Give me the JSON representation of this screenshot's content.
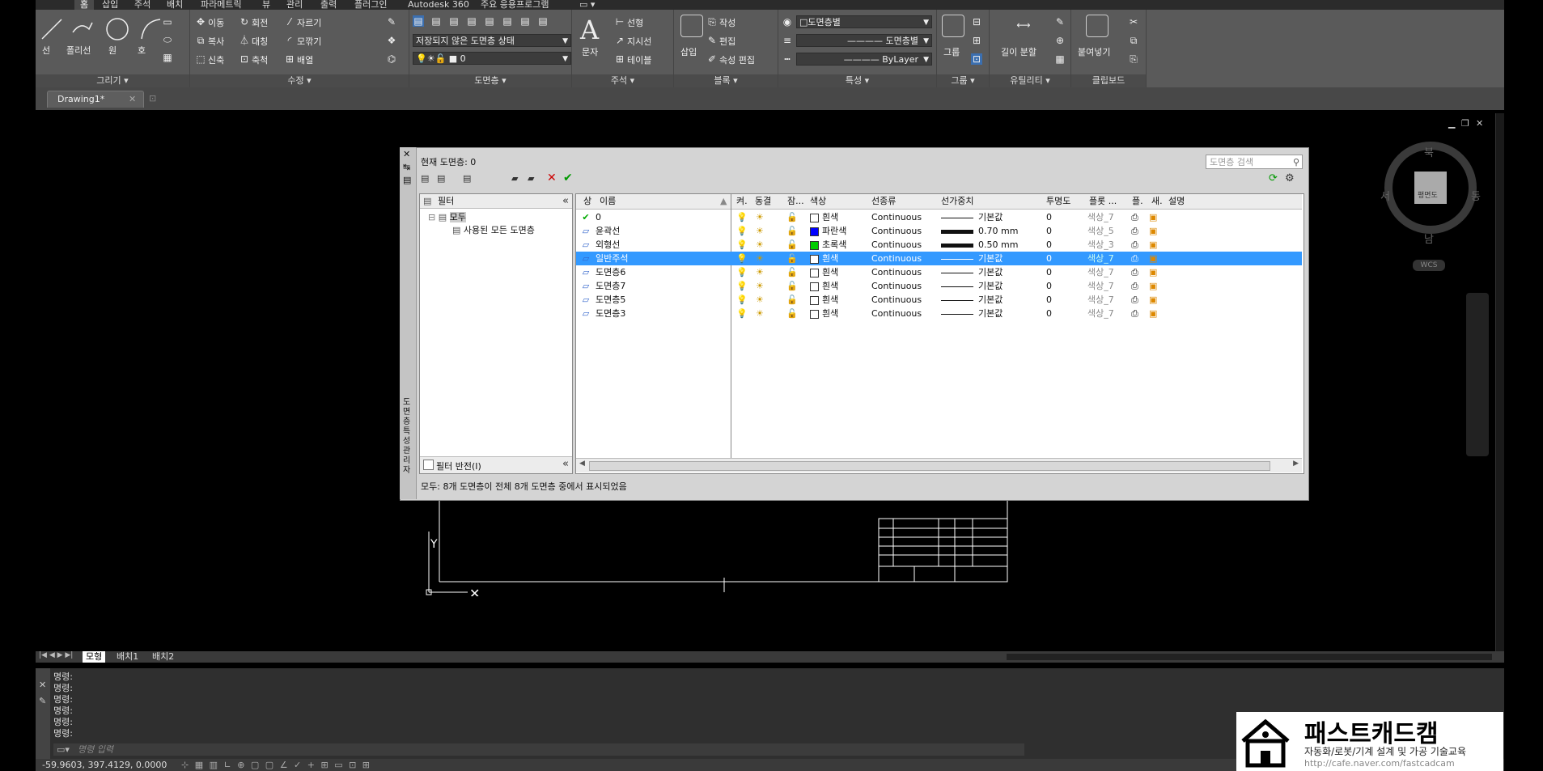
{
  "menu": {
    "tabs": [
      "홈",
      "삽입",
      "주석",
      "배치",
      "파라메트릭",
      "뷰",
      "관리",
      "출력",
      "플러그인",
      "Autodesk 360",
      "주요 응용프로그램"
    ]
  },
  "ribbon": {
    "draw": {
      "title": "그리기 ▾",
      "line": "선",
      "polyline": "폴리선",
      "circle": "원",
      "arc": "호"
    },
    "modify": {
      "title": "수정 ▾",
      "move": "이동",
      "rotate": "회전",
      "trim": "자르기",
      "copy": "복사",
      "mirror": "대칭",
      "fillet": "모깎기",
      "stretch": "신축",
      "scale": "축척",
      "array": "배열"
    },
    "layers": {
      "title": "도면층 ▾",
      "state": "저장되지 않은 도면층 상태",
      "current": "0"
    },
    "annotation": {
      "title": "주석 ▾",
      "text": "문자",
      "linear": "선형",
      "leader": "지시선",
      "table": "테이블"
    },
    "block": {
      "title": "블록 ▾",
      "insert": "삽입",
      "create": "작성",
      "edit": "편집",
      "attr_edit": "속성 편집"
    },
    "properties": {
      "title": "특성 ▾",
      "color": "도면층별",
      "linetype": "도면층별",
      "lineweight": "ByLayer"
    },
    "groups": {
      "title": "그룹 ▾",
      "group": "그룹"
    },
    "utilities": {
      "title": "유틸리티 ▾",
      "measure": "길이 분할"
    },
    "clipboard": {
      "title": "클립보드",
      "paste": "붙여넣기"
    }
  },
  "doc_tab": {
    "name": "Drawing1*"
  },
  "dialog": {
    "current_layer": "현재 도면층: 0",
    "search_placeholder": "도면층 검색",
    "filter_header": "필터",
    "filter_tree": {
      "all": "모두",
      "used": "사용된 모든 도면층"
    },
    "invert_filter": "필터 반전(I)",
    "side_label": "도면층 특성 관리자",
    "columns": {
      "status": "상",
      "name": "이름",
      "on": "켜.",
      "freeze": "동결",
      "lock": "잠...",
      "color": "색상",
      "linetype": "선종류",
      "lineweight": "선가중치",
      "transparency": "투명도",
      "plot_style": "플롯 ...",
      "plot": "플.",
      "new_vp": "새.",
      "description": "설명"
    },
    "layers": [
      {
        "name": "0",
        "color_name": "흰색",
        "color": "#ffffff",
        "linetype": "Continuous",
        "lineweight": "기본값",
        "heavy": false,
        "transparency": "0",
        "plot_style": "색상_7",
        "current": true,
        "selected": false
      },
      {
        "name": "윤곽선",
        "color_name": "파란색",
        "color": "#0000ff",
        "linetype": "Continuous",
        "lineweight": "0.70 mm",
        "heavy": true,
        "transparency": "0",
        "plot_style": "색상_5",
        "current": false,
        "selected": false
      },
      {
        "name": "외형선",
        "color_name": "초록색",
        "color": "#00cc00",
        "linetype": "Continuous",
        "lineweight": "0.50 mm",
        "heavy": true,
        "transparency": "0",
        "plot_style": "색상_3",
        "current": false,
        "selected": false
      },
      {
        "name": "일반주석",
        "color_name": "흰색",
        "color": "#ffffff",
        "linetype": "Continuous",
        "lineweight": "기본값",
        "heavy": false,
        "transparency": "0",
        "plot_style": "색상_7",
        "current": false,
        "selected": true
      },
      {
        "name": "도면층6",
        "color_name": "흰색",
        "color": "#ffffff",
        "linetype": "Continuous",
        "lineweight": "기본값",
        "heavy": false,
        "transparency": "0",
        "plot_style": "색상_7",
        "current": false,
        "selected": false
      },
      {
        "name": "도면층7",
        "color_name": "흰색",
        "color": "#ffffff",
        "linetype": "Continuous",
        "lineweight": "기본값",
        "heavy": false,
        "transparency": "0",
        "plot_style": "색상_7",
        "current": false,
        "selected": false
      },
      {
        "name": "도면층5",
        "color_name": "흰색",
        "color": "#ffffff",
        "linetype": "Continuous",
        "lineweight": "기본값",
        "heavy": false,
        "transparency": "0",
        "plot_style": "색상_7",
        "current": false,
        "selected": false
      },
      {
        "name": "도면층3",
        "color_name": "흰색",
        "color": "#ffffff",
        "linetype": "Continuous",
        "lineweight": "기본값",
        "heavy": false,
        "transparency": "0",
        "plot_style": "색상_7",
        "current": false,
        "selected": false
      }
    ],
    "status_text": "모두: 8개 도면층이 전체 8개 도면층 중에서 표시되었음"
  },
  "viewcube": {
    "north": "북",
    "south": "남",
    "east": "동",
    "west": "서",
    "face": "평면도",
    "wcs": "WCS"
  },
  "layout_tabs": [
    "모형",
    "배치1",
    "배치2"
  ],
  "command": {
    "lines": [
      "명령:",
      "명령:",
      "명령:",
      "명령:",
      "명령:",
      "명령:"
    ],
    "placeholder": "명령 입력"
  },
  "coords": "-59.9603, 397.4129, 0.0000",
  "watermark": {
    "title": "패스트캐드캠",
    "subtitle": "자동화/로봇/기계 설계 및 가공 기술교육",
    "url": "http://cafe.naver.com/fastcadcam"
  },
  "colors": {
    "selection": "#3399ff",
    "ribbon": "#5a5a5a",
    "canvas": "#000000"
  }
}
